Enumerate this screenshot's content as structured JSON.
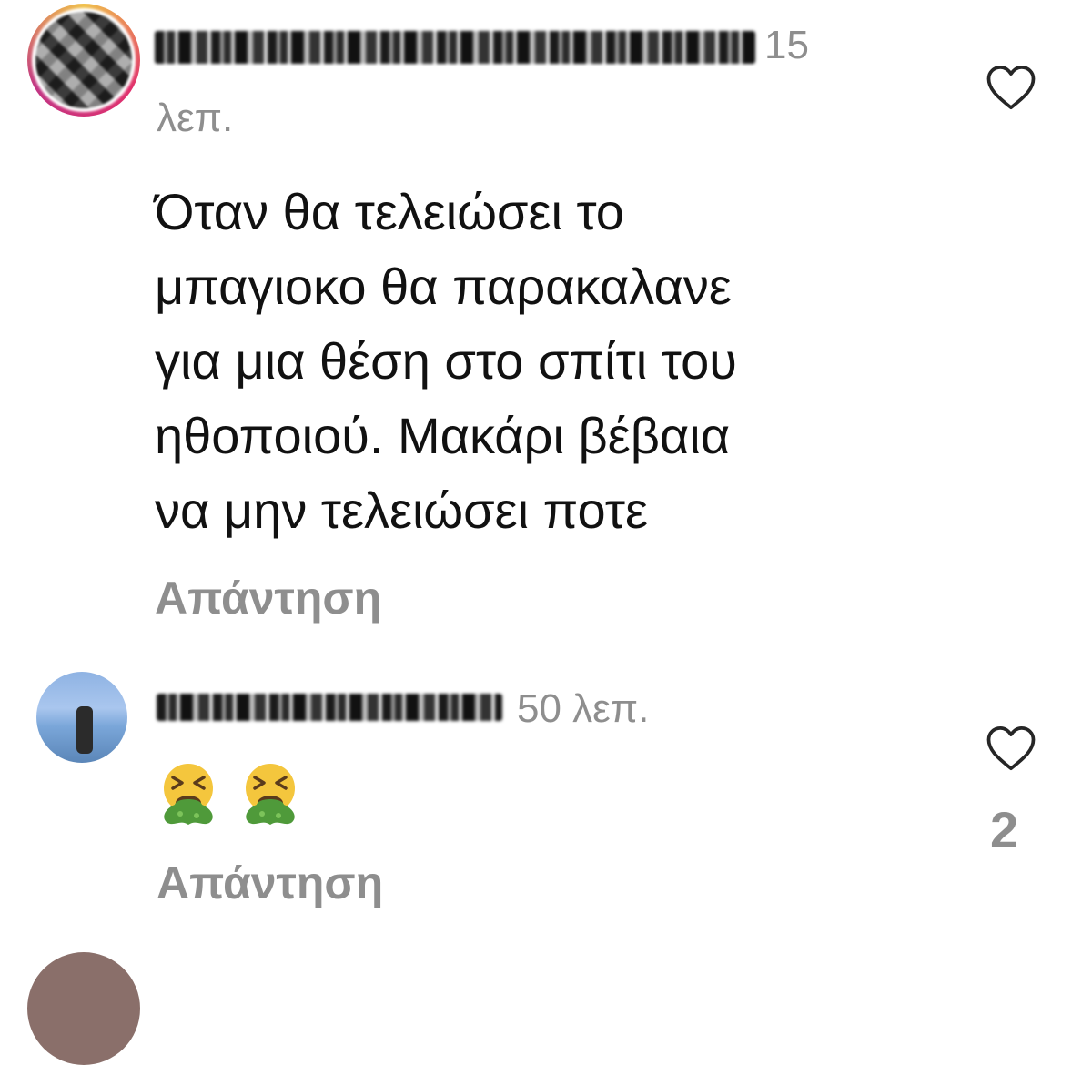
{
  "comments": [
    {
      "time_part1": "15",
      "time_part2": "λεπ.",
      "text": "Όταν θα τελειώσει το\nμπαγιοκο θα παρακαλανε\nγια μια θέση στο σπίτι του\nηθοποιού.  Μακάρι βέβαια\nνα μην τελειώσει ποτε",
      "reply_label": "Απάντηση",
      "icon": "heart-outline-icon"
    },
    {
      "time": "50 λεπ.",
      "emojis": [
        "vomiting-face-emoji",
        "vomiting-face-emoji"
      ],
      "reply_label": "Απάντηση",
      "likes": "2",
      "icon": "heart-outline-icon"
    }
  ],
  "colors": {
    "text": "#111111",
    "secondary": "#8e8e8e",
    "background": "#ffffff",
    "emoji_face": "#f4c63d",
    "emoji_vomit": "#4f9a3a"
  }
}
